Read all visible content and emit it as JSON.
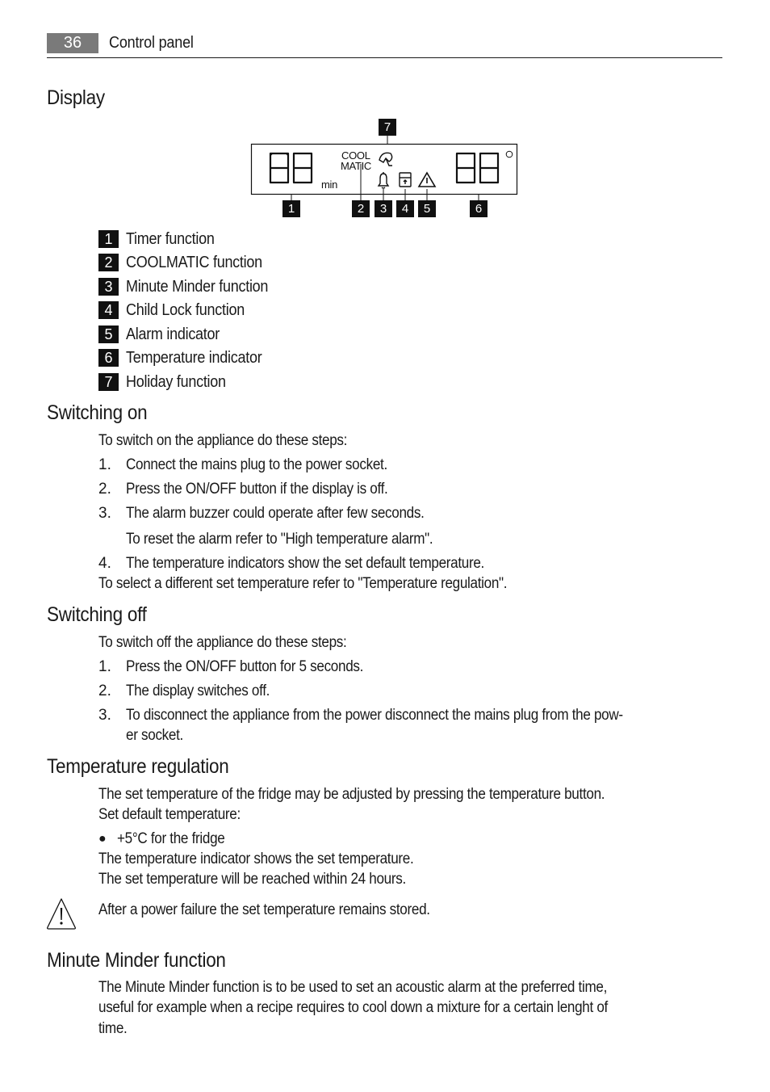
{
  "header": {
    "page_number": "36",
    "section_title": "Control panel"
  },
  "display_section": {
    "heading": "Display",
    "diagram": {
      "lcd_left_digits": "88",
      "lcd_left_unit": "min",
      "lcd_label_line1": "COOL",
      "lcd_label_line2": "MATIC",
      "lcd_right_digits": "88",
      "lcd_right_unit": "°",
      "icons": [
        "holiday-umbrella-icon",
        "bell-icon",
        "child-lock-icon",
        "warning-triangle-icon"
      ],
      "callouts": [
        "1",
        "2",
        "3",
        "4",
        "5",
        "6",
        "7"
      ]
    },
    "legend": [
      {
        "num": "1",
        "label": "Timer function"
      },
      {
        "num": "2",
        "label": "COOLMATIC function"
      },
      {
        "num": "3",
        "label": "Minute Minder function"
      },
      {
        "num": "4",
        "label": "Child Lock function"
      },
      {
        "num": "5",
        "label": "Alarm indicator"
      },
      {
        "num": "6",
        "label": "Temperature indicator"
      },
      {
        "num": "7",
        "label": "Holiday function"
      }
    ]
  },
  "switching_on": {
    "heading": "Switching on",
    "intro": "To switch on the appliance do these steps:",
    "steps": [
      {
        "num": "1.",
        "text": "Connect the mains plug to the power socket."
      },
      {
        "num": "2.",
        "text": "Press the ON/OFF button if the display is off."
      },
      {
        "num": "3.",
        "text": "The alarm buzzer could operate after few seconds."
      },
      {
        "num": "",
        "text": "To reset the alarm refer to \"High temperature alarm\"."
      },
      {
        "num": "4.",
        "text": "The temperature indicators show the set default temperature."
      }
    ],
    "outro": "To select a different set temperature refer to \"Temperature regulation\"."
  },
  "switching_off": {
    "heading": "Switching off",
    "intro": "To switch off the appliance do these steps:",
    "steps": [
      {
        "num": "1.",
        "text": "Press the ON/OFF button for 5 seconds."
      },
      {
        "num": "2.",
        "text": "The display switches off."
      },
      {
        "num": "3.",
        "text": "To disconnect the appliance from the power disconnect the mains plug from the pow-",
        "text2": "er socket."
      }
    ]
  },
  "temperature_regulation": {
    "heading": "Temperature regulation",
    "para1": "The set temperature of the fridge may be adjusted by pressing the temperature button.",
    "para2": "Set default temperature:",
    "bullet": "+5°C for the fridge",
    "para3": "The temperature indicator shows the set temperature.",
    "para4": "The set temperature will be reached within 24 hours.",
    "warning": "After a power failure the set temperature remains stored."
  },
  "minute_minder": {
    "heading": "Minute Minder function",
    "line1": "The Minute Minder function is to be used to set an acoustic alarm at the preferred time,",
    "line2": "useful for example when a recipe requires to cool down a mixture for a certain lenght of",
    "line3": "time."
  }
}
